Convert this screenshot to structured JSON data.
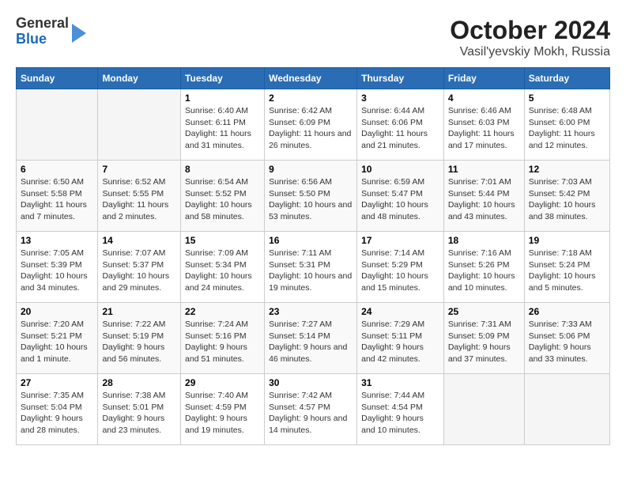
{
  "header": {
    "logo_general": "General",
    "logo_blue": "Blue",
    "title": "October 2024",
    "subtitle": "Vasil'yevskiy Mokh, Russia"
  },
  "days_of_week": [
    "Sunday",
    "Monday",
    "Tuesday",
    "Wednesday",
    "Thursday",
    "Friday",
    "Saturday"
  ],
  "weeks": [
    [
      {
        "day": "",
        "sunrise": "",
        "sunset": "",
        "daylight": "",
        "empty": true
      },
      {
        "day": "",
        "sunrise": "",
        "sunset": "",
        "daylight": "",
        "empty": true
      },
      {
        "day": "1",
        "sunrise": "Sunrise: 6:40 AM",
        "sunset": "Sunset: 6:11 PM",
        "daylight": "Daylight: 11 hours and 31 minutes."
      },
      {
        "day": "2",
        "sunrise": "Sunrise: 6:42 AM",
        "sunset": "Sunset: 6:09 PM",
        "daylight": "Daylight: 11 hours and 26 minutes."
      },
      {
        "day": "3",
        "sunrise": "Sunrise: 6:44 AM",
        "sunset": "Sunset: 6:06 PM",
        "daylight": "Daylight: 11 hours and 21 minutes."
      },
      {
        "day": "4",
        "sunrise": "Sunrise: 6:46 AM",
        "sunset": "Sunset: 6:03 PM",
        "daylight": "Daylight: 11 hours and 17 minutes."
      },
      {
        "day": "5",
        "sunrise": "Sunrise: 6:48 AM",
        "sunset": "Sunset: 6:00 PM",
        "daylight": "Daylight: 11 hours and 12 minutes."
      }
    ],
    [
      {
        "day": "6",
        "sunrise": "Sunrise: 6:50 AM",
        "sunset": "Sunset: 5:58 PM",
        "daylight": "Daylight: 11 hours and 7 minutes."
      },
      {
        "day": "7",
        "sunrise": "Sunrise: 6:52 AM",
        "sunset": "Sunset: 5:55 PM",
        "daylight": "Daylight: 11 hours and 2 minutes."
      },
      {
        "day": "8",
        "sunrise": "Sunrise: 6:54 AM",
        "sunset": "Sunset: 5:52 PM",
        "daylight": "Daylight: 10 hours and 58 minutes."
      },
      {
        "day": "9",
        "sunrise": "Sunrise: 6:56 AM",
        "sunset": "Sunset: 5:50 PM",
        "daylight": "Daylight: 10 hours and 53 minutes."
      },
      {
        "day": "10",
        "sunrise": "Sunrise: 6:59 AM",
        "sunset": "Sunset: 5:47 PM",
        "daylight": "Daylight: 10 hours and 48 minutes."
      },
      {
        "day": "11",
        "sunrise": "Sunrise: 7:01 AM",
        "sunset": "Sunset: 5:44 PM",
        "daylight": "Daylight: 10 hours and 43 minutes."
      },
      {
        "day": "12",
        "sunrise": "Sunrise: 7:03 AM",
        "sunset": "Sunset: 5:42 PM",
        "daylight": "Daylight: 10 hours and 38 minutes."
      }
    ],
    [
      {
        "day": "13",
        "sunrise": "Sunrise: 7:05 AM",
        "sunset": "Sunset: 5:39 PM",
        "daylight": "Daylight: 10 hours and 34 minutes."
      },
      {
        "day": "14",
        "sunrise": "Sunrise: 7:07 AM",
        "sunset": "Sunset: 5:37 PM",
        "daylight": "Daylight: 10 hours and 29 minutes."
      },
      {
        "day": "15",
        "sunrise": "Sunrise: 7:09 AM",
        "sunset": "Sunset: 5:34 PM",
        "daylight": "Daylight: 10 hours and 24 minutes."
      },
      {
        "day": "16",
        "sunrise": "Sunrise: 7:11 AM",
        "sunset": "Sunset: 5:31 PM",
        "daylight": "Daylight: 10 hours and 19 minutes."
      },
      {
        "day": "17",
        "sunrise": "Sunrise: 7:14 AM",
        "sunset": "Sunset: 5:29 PM",
        "daylight": "Daylight: 10 hours and 15 minutes."
      },
      {
        "day": "18",
        "sunrise": "Sunrise: 7:16 AM",
        "sunset": "Sunset: 5:26 PM",
        "daylight": "Daylight: 10 hours and 10 minutes."
      },
      {
        "day": "19",
        "sunrise": "Sunrise: 7:18 AM",
        "sunset": "Sunset: 5:24 PM",
        "daylight": "Daylight: 10 hours and 5 minutes."
      }
    ],
    [
      {
        "day": "20",
        "sunrise": "Sunrise: 7:20 AM",
        "sunset": "Sunset: 5:21 PM",
        "daylight": "Daylight: 10 hours and 1 minute."
      },
      {
        "day": "21",
        "sunrise": "Sunrise: 7:22 AM",
        "sunset": "Sunset: 5:19 PM",
        "daylight": "Daylight: 9 hours and 56 minutes."
      },
      {
        "day": "22",
        "sunrise": "Sunrise: 7:24 AM",
        "sunset": "Sunset: 5:16 PM",
        "daylight": "Daylight: 9 hours and 51 minutes."
      },
      {
        "day": "23",
        "sunrise": "Sunrise: 7:27 AM",
        "sunset": "Sunset: 5:14 PM",
        "daylight": "Daylight: 9 hours and 46 minutes."
      },
      {
        "day": "24",
        "sunrise": "Sunrise: 7:29 AM",
        "sunset": "Sunset: 5:11 PM",
        "daylight": "Daylight: 9 hours and 42 minutes."
      },
      {
        "day": "25",
        "sunrise": "Sunrise: 7:31 AM",
        "sunset": "Sunset: 5:09 PM",
        "daylight": "Daylight: 9 hours and 37 minutes."
      },
      {
        "day": "26",
        "sunrise": "Sunrise: 7:33 AM",
        "sunset": "Sunset: 5:06 PM",
        "daylight": "Daylight: 9 hours and 33 minutes."
      }
    ],
    [
      {
        "day": "27",
        "sunrise": "Sunrise: 7:35 AM",
        "sunset": "Sunset: 5:04 PM",
        "daylight": "Daylight: 9 hours and 28 minutes."
      },
      {
        "day": "28",
        "sunrise": "Sunrise: 7:38 AM",
        "sunset": "Sunset: 5:01 PM",
        "daylight": "Daylight: 9 hours and 23 minutes."
      },
      {
        "day": "29",
        "sunrise": "Sunrise: 7:40 AM",
        "sunset": "Sunset: 4:59 PM",
        "daylight": "Daylight: 9 hours and 19 minutes."
      },
      {
        "day": "30",
        "sunrise": "Sunrise: 7:42 AM",
        "sunset": "Sunset: 4:57 PM",
        "daylight": "Daylight: 9 hours and 14 minutes."
      },
      {
        "day": "31",
        "sunrise": "Sunrise: 7:44 AM",
        "sunset": "Sunset: 4:54 PM",
        "daylight": "Daylight: 9 hours and 10 minutes."
      },
      {
        "day": "",
        "sunrise": "",
        "sunset": "",
        "daylight": "",
        "empty": true
      },
      {
        "day": "",
        "sunrise": "",
        "sunset": "",
        "daylight": "",
        "empty": true
      }
    ]
  ]
}
